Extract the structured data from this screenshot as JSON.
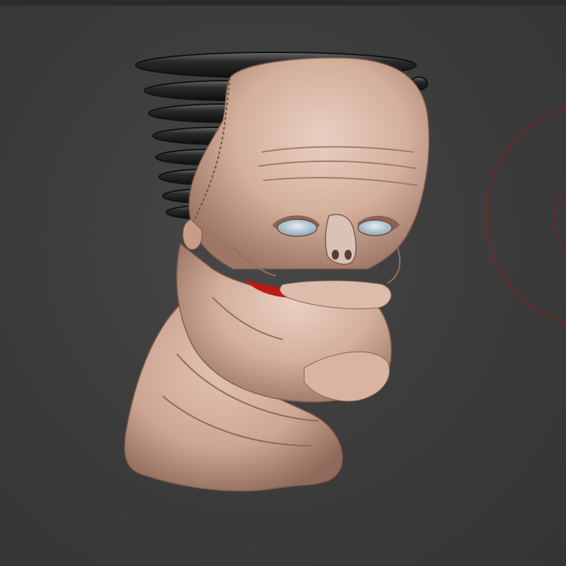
{
  "viewport": {
    "background_color": "#3a3a3a",
    "top_bar_color": "#2b2b2b",
    "canvas_description_icon": "3d-sculpt-canvas"
  },
  "model": {
    "icon": "sculpted-head-model",
    "skin_color": "#d9b9a6",
    "skin_shadow_color": "#9b7565",
    "eye_color": "#b8c9d6",
    "coil_color": "#222222",
    "wound_color": "#c01818"
  },
  "brush_cursor": {
    "icon": "brush-radius-cursor",
    "color": "#8e1e1e"
  }
}
